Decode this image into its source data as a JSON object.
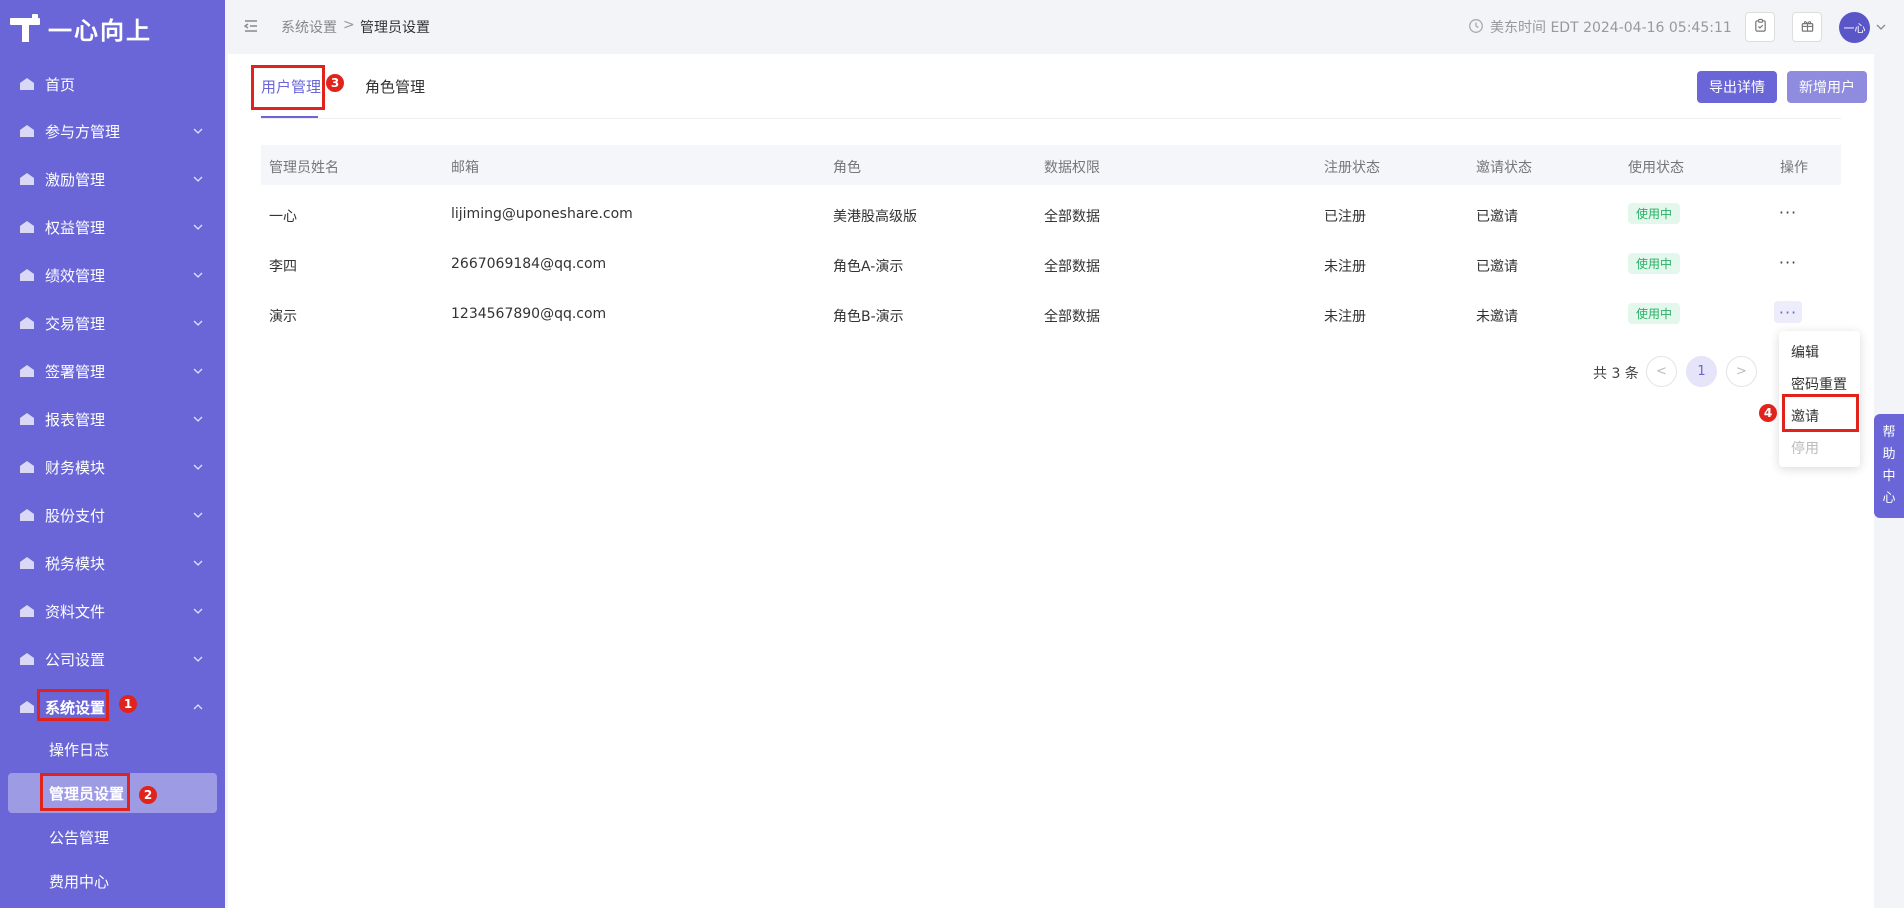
{
  "app": {
    "logo_text": "一心向上"
  },
  "sidebar": {
    "items": [
      {
        "label": "首页",
        "icon": "home-icon"
      },
      {
        "label": "参与方管理",
        "icon": "stakeholder-icon"
      },
      {
        "label": "激励管理",
        "icon": "incentive-icon"
      },
      {
        "label": "权益管理",
        "icon": "equity-icon"
      },
      {
        "label": "绩效管理",
        "icon": "performance-icon"
      },
      {
        "label": "交易管理",
        "icon": "transaction-icon"
      },
      {
        "label": "签署管理",
        "icon": "sign-icon"
      },
      {
        "label": "报表管理",
        "icon": "report-icon"
      },
      {
        "label": "财务模块",
        "icon": "finance-icon"
      },
      {
        "label": "股份支付",
        "icon": "share-payment-icon"
      },
      {
        "label": "税务模块",
        "icon": "tax-icon"
      },
      {
        "label": "资料文件",
        "icon": "folder-icon"
      },
      {
        "label": "公司设置",
        "icon": "company-icon"
      },
      {
        "label": "系统设置",
        "icon": "system-settings-icon"
      }
    ],
    "submenu": [
      {
        "label": "操作日志"
      },
      {
        "label": "管理员设置"
      },
      {
        "label": "公告管理"
      },
      {
        "label": "费用中心"
      }
    ]
  },
  "header": {
    "breadcrumb": [
      "系统设置",
      "管理员设置"
    ],
    "breadcrumb_sep": ">",
    "time": "美东时间 EDT 2024-04-16 05:45:11",
    "avatar_text": "一心"
  },
  "tabs": [
    {
      "label": "用户管理"
    },
    {
      "label": "角色管理"
    }
  ],
  "actions": {
    "export": "导出详情",
    "add_user": "新增用户"
  },
  "table": {
    "columns": [
      "管理员姓名",
      "邮箱",
      "角色",
      "数据权限",
      "注册状态",
      "邀请状态",
      "使用状态",
      "操作"
    ],
    "rows": [
      {
        "name": "一心",
        "email": "lijiming@uponeshare.com",
        "role": "美港股高级版",
        "data_scope": "全部数据",
        "reg": "已注册",
        "invite": "已邀请",
        "use": "使用中"
      },
      {
        "name": "李四",
        "email": "2667069184@qq.com",
        "role": "角色A-演示",
        "data_scope": "全部数据",
        "reg": "未注册",
        "invite": "已邀请",
        "use": "使用中"
      },
      {
        "name": "演示",
        "email": "1234567890@qq.com",
        "role": "角色B-演示",
        "data_scope": "全部数据",
        "reg": "未注册",
        "invite": "未邀请",
        "use": "使用中"
      }
    ],
    "more_glyph": "···"
  },
  "pagination": {
    "total": "共 3 条",
    "prev": "<",
    "page": "1",
    "next": ">"
  },
  "dropdown": {
    "items": [
      "编辑",
      "密码重置",
      "邀请",
      "停用"
    ]
  },
  "annotations": [
    "1",
    "2",
    "3",
    "4"
  ],
  "help": {
    "chars": [
      "帮",
      "助",
      "中",
      "心"
    ]
  },
  "colors": {
    "accent": "#6a66d8",
    "annotation": "#e0241d",
    "success": "#2ab066"
  }
}
